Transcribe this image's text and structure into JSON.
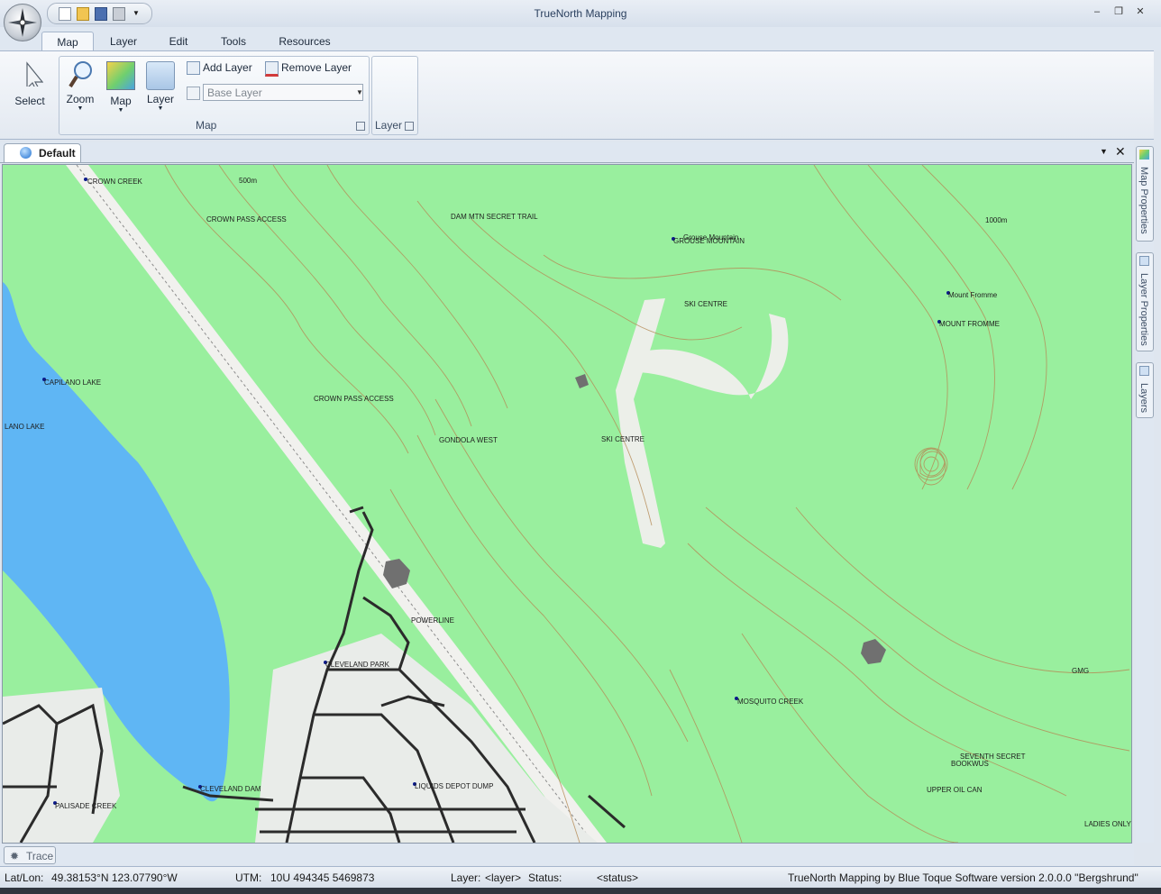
{
  "app": {
    "title": "TrueNorth Mapping"
  },
  "ribbon_tabs": [
    "Map",
    "Layer",
    "Edit",
    "Tools",
    "Resources"
  ],
  "ribbon": {
    "select_label": "Select",
    "zoom_label": "Zoom",
    "map_label": "Map",
    "layer_label": "Layer",
    "add_layer_label": "Add Layer",
    "remove_layer_label": "Remove Layer",
    "base_layer_placeholder": "Base Layer",
    "map_group_label": "Map",
    "layer_group_label": "Layer"
  },
  "document": {
    "tab_label": "Default"
  },
  "side_panels": [
    "Map Properties",
    "Layer Properties",
    "Layers"
  ],
  "map": {
    "labels": {
      "crown_creek": "CROWN CREEK",
      "m500": "500m",
      "crown_pass_access": "CROWN PASS ACCESS",
      "dam_mtn": "DAM MTN SECRET TRAIL",
      "grouse_mountain": "GROUSE MOUNTAIN",
      "grouse_mountain_small": "Grouse Mountain",
      "m1000": "1000m",
      "ski_centre_1": "SKI CENTRE",
      "mount_fromme_small": "Mount Fromme",
      "mount_fromme": "MOUNT FROMME",
      "capilano_lake": "CAPILANO LAKE",
      "lano_lake": "LANO LAKE",
      "crown_pass_access_2": "CROWN PASS ACCESS",
      "gondola_west": "GONDOLA WEST",
      "ski_centre_2": "SKI CENTRE",
      "powerline": "POWERLINE",
      "cleveland_park": "CLEVELAND PARK",
      "gmg": "GMG",
      "mosquito_creek": "MOSQUITO CREEK",
      "seventh_secret": "SEVENTH SECRET",
      "bookwus": "BOOKWUS",
      "liquids_depot_dump": "LIQUIDS DEPOT DUMP",
      "cleveland_dam": "CLEVELAND DAM",
      "upper_oil_can": "UPPER OIL CAN",
      "ladies_only": "LADIES ONLY",
      "palisade_creek": "PALISADE CREEK"
    },
    "colors": {
      "land": "#99ef9e",
      "water": "#5fb6f4",
      "contour": "#b58a55",
      "road": "#2b2b2b",
      "urban": "#e9ece9"
    }
  },
  "trace": {
    "label": "Trace"
  },
  "status": {
    "latlon_label": "Lat/Lon:",
    "latlon_value": "49.38153°N 123.07790°W",
    "utm_label": "UTM:",
    "utm_value": "10U 494345 5469873",
    "layer_label": "Layer:",
    "layer_value": "<layer>",
    "status_label": "Status:",
    "status_value": "<status>",
    "credit": "TrueNorth Mapping by Blue Toque Software version 2.0.0.0 \"Bergshrund\""
  }
}
